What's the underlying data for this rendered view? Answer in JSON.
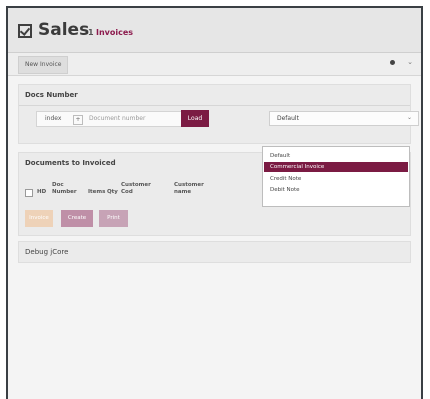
{
  "app": {
    "title": "Sales",
    "breadcrumb_number": "1",
    "breadcrumb_link": "Invoices",
    "accent_color": "#7b1b43"
  },
  "toolbar": {
    "new_tab_label": "New Invoice",
    "settings_icon": "gear-icon",
    "user_icon": "user-icon"
  },
  "docs_panel": {
    "title": "Docs Number",
    "index_label": "index",
    "index_plus": "+",
    "document_placeholder": "Document number",
    "load_label": "Load",
    "select_value": "Default",
    "select_options": [
      "Default",
      "Commercial Invoice",
      "Credit Note",
      "Debit Note"
    ],
    "selected_option": "Commercial Invoice"
  },
  "invoice_panel": {
    "title": "Documents to Invoiced",
    "columns": [
      "HD",
      "Doc Number",
      "Items",
      "Qty",
      "Customer Cod",
      "Customer name"
    ],
    "buttons": [
      "Invoice",
      "Create",
      "Print"
    ]
  },
  "debug_panel": {
    "title": "Debug jCore"
  }
}
